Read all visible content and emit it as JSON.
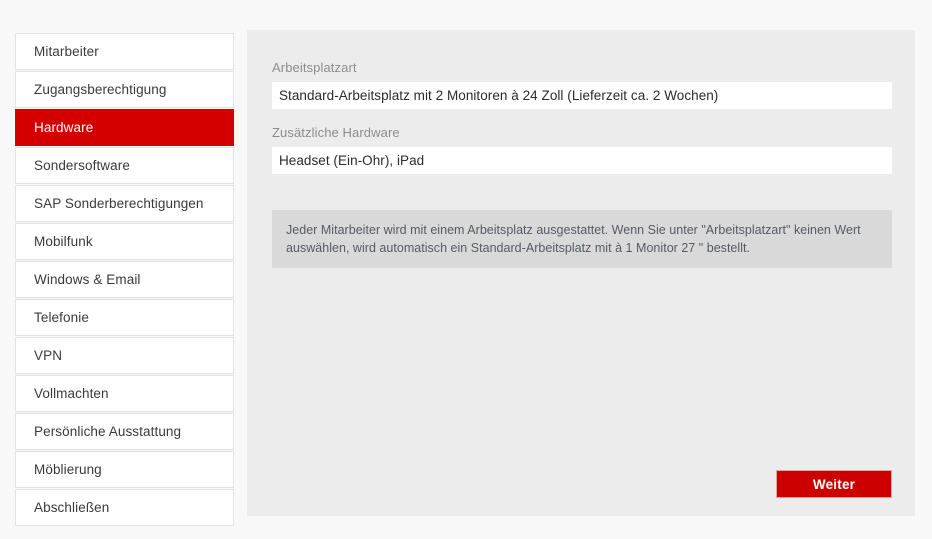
{
  "sidebar": {
    "items": [
      {
        "label": "Mitarbeiter",
        "active": false
      },
      {
        "label": "Zugangsberechtigung",
        "active": false
      },
      {
        "label": "Hardware",
        "active": true
      },
      {
        "label": "Sondersoftware",
        "active": false
      },
      {
        "label": "SAP Sonderberechtigungen",
        "active": false
      },
      {
        "label": "Mobilfunk",
        "active": false
      },
      {
        "label": "Windows & Email",
        "active": false
      },
      {
        "label": "Telefonie",
        "active": false
      },
      {
        "label": "VPN",
        "active": false
      },
      {
        "label": "Vollmachten",
        "active": false
      },
      {
        "label": "Persönliche Ausstattung",
        "active": false
      },
      {
        "label": "Möblierung",
        "active": false
      },
      {
        "label": "Abschließen",
        "active": false
      }
    ]
  },
  "main": {
    "fields": [
      {
        "label": "Arbeitsplatzart",
        "value": "Standard-Arbeitsplatz mit 2 Monitoren à 24 Zoll (Lieferzeit ca. 2 Wochen)",
        "placeholder": ""
      },
      {
        "label": "Zusätzliche Hardware",
        "value": "Headset (Ein-Ohr), iPad",
        "placeholder": ""
      }
    ],
    "info_text": "Jeder Mitarbeiter wird mit einem Arbeitsplatz ausgestattet. Wenn Sie unter \"Arbeitsplatzart\" keinen Wert auswählen, wird automatisch ein Standard-Arbeitsplatz mit à 1 Monitor 27 \" bestellt.",
    "next_button_label": "Weiter"
  },
  "colors": {
    "accent_red": "#d40000",
    "button_red": "#cc0000",
    "panel_bg": "#ececec",
    "info_bg": "#d9d9d9",
    "page_bg": "#f8f8f8"
  }
}
